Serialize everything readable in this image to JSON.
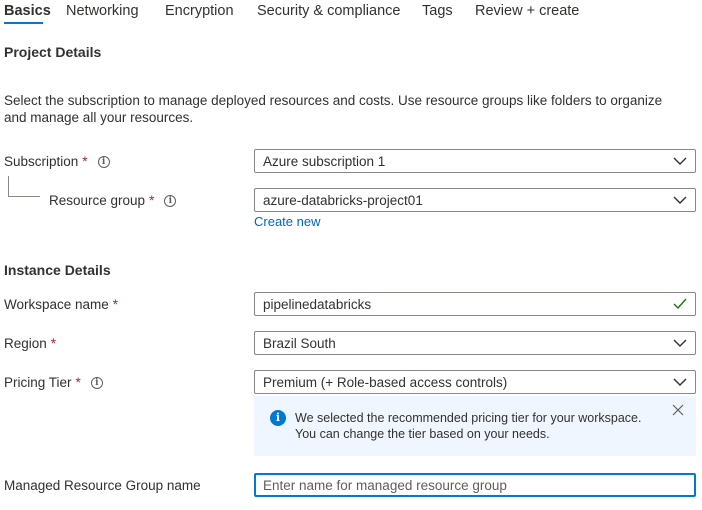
{
  "tabs": [
    {
      "label": "Basics",
      "active": true
    },
    {
      "label": "Networking"
    },
    {
      "label": "Encryption"
    },
    {
      "label": "Security & compliance"
    },
    {
      "label": "Tags"
    },
    {
      "label": "Review + create"
    }
  ],
  "project": {
    "heading": "Project Details",
    "description": "Select the subscription to manage deployed resources and costs. Use resource groups like folders to organize and manage all your resources.",
    "subscription": {
      "label": "Subscription",
      "required": "*",
      "value": "Azure subscription 1"
    },
    "resource_group": {
      "label": "Resource group",
      "required": "*",
      "value": "azure-databricks-project01",
      "create_new": "Create new"
    }
  },
  "instance": {
    "heading": "Instance Details",
    "workspace_name": {
      "label": "Workspace name",
      "required": "*",
      "value": "pipelinedatabricks"
    },
    "region": {
      "label": "Region",
      "required": "*",
      "value": "Brazil South"
    },
    "pricing_tier": {
      "label": "Pricing Tier",
      "required": "*",
      "value": "Premium (+ Role-based access controls)"
    },
    "info_message": "We selected the recommended pricing tier for your workspace. You can change the tier based on your needs.",
    "managed_rg": {
      "label": "Managed Resource Group name",
      "placeholder": "Enter name for managed resource group"
    }
  },
  "colors": {
    "accent": "#0078d4",
    "required": "#a4262c",
    "valid": "#107c10",
    "link": "#0067b8"
  },
  "icons": {
    "info": "info-icon",
    "chevron": "chevron-down-icon",
    "check": "checkmark-icon",
    "close": "close-icon"
  }
}
